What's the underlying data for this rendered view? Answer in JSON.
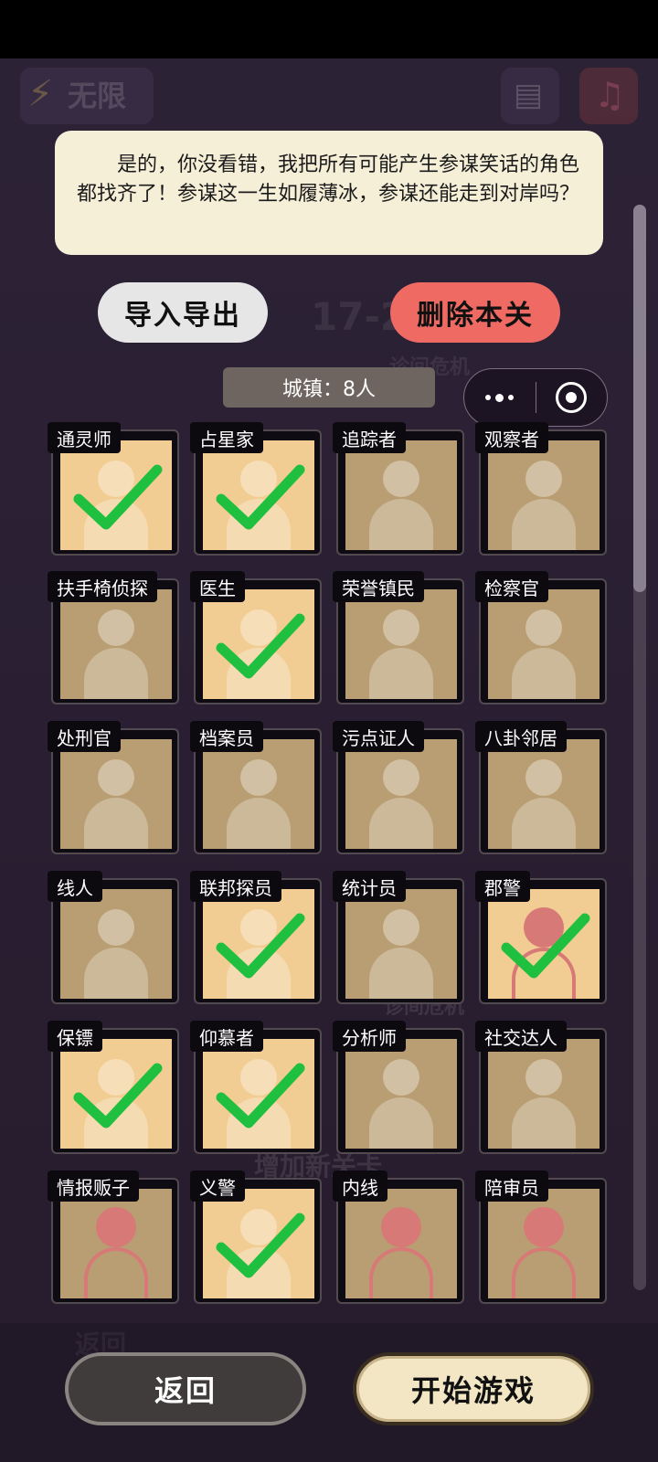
{
  "colors": {
    "accent_delete": "#f06a64",
    "checkmark": "#1fbf3f",
    "tip_background": "#f5efd8",
    "portrait_checked": "#f2cd93",
    "portrait_unchecked": "#b89e72"
  },
  "background": {
    "energy_text": "无限",
    "level_text": "17-2",
    "crisis_text": "诊间危机",
    "add_level_text": "增加新关卡",
    "back_ghost": "返回"
  },
  "tip": {
    "text": "是的，你没看错，我把所有可能产生参谋笑话的角色都找齐了！参谋这一生如履薄冰，参谋还能走到对岸吗？"
  },
  "actions": {
    "import_export": "导入导出",
    "delete_level": "删除本关"
  },
  "town": {
    "label": "城镇：8人"
  },
  "miniprogram": {
    "menu_icon": "more-dots-icon",
    "close_icon": "target-icon"
  },
  "roles": [
    {
      "name": "通灵师",
      "checked": true
    },
    {
      "name": "占星家",
      "checked": true
    },
    {
      "name": "追踪者",
      "checked": false
    },
    {
      "name": "观察者",
      "checked": false
    },
    {
      "name": "扶手椅侦探",
      "checked": false
    },
    {
      "name": "医生",
      "checked": true
    },
    {
      "name": "荣誉镇民",
      "checked": false
    },
    {
      "name": "检察官",
      "checked": false
    },
    {
      "name": "处刑官",
      "checked": false
    },
    {
      "name": "档案员",
      "checked": false
    },
    {
      "name": "污点证人",
      "checked": false
    },
    {
      "name": "八卦邻居",
      "checked": false
    },
    {
      "name": "线人",
      "checked": false
    },
    {
      "name": "联邦探员",
      "checked": true
    },
    {
      "name": "统计员",
      "checked": false
    },
    {
      "name": "郡警",
      "checked": true
    },
    {
      "name": "保镖",
      "checked": true
    },
    {
      "name": "仰慕者",
      "checked": true
    },
    {
      "name": "分析师",
      "checked": false
    },
    {
      "name": "社交达人",
      "checked": false
    },
    {
      "name": "情报贩子",
      "checked": false
    },
    {
      "name": "义警",
      "checked": true
    },
    {
      "name": "内线",
      "checked": false
    },
    {
      "name": "陪审员",
      "checked": false
    }
  ],
  "footer": {
    "back": "返回",
    "start": "开始游戏"
  }
}
